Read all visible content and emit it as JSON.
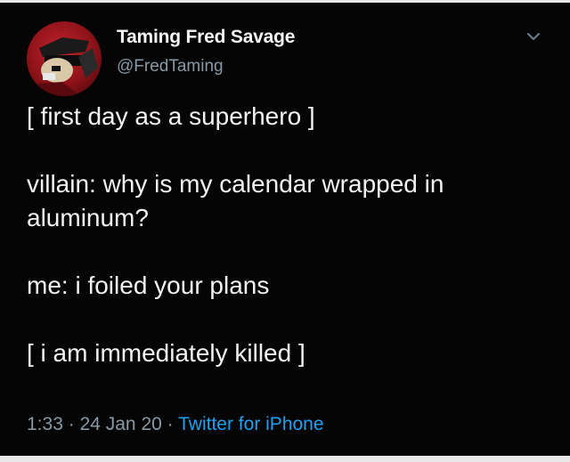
{
  "author": {
    "display_name": "Taming Fred Savage",
    "handle": "@FredTaming"
  },
  "tweet": {
    "paragraphs": [
      "[ first day as a superhero ]",
      "villain: why is my calendar wrapped in aluminum?",
      "me: i foiled your plans",
      "[ i am immediately killed ]"
    ],
    "time": "1:33",
    "separator": "·",
    "date": "24 Jan 20",
    "source": "Twitter for iPhone"
  },
  "icons": {
    "more": "chevron-down-icon",
    "avatar": "avatar"
  },
  "colors": {
    "background": "#050505",
    "text": "#f2f2f2",
    "secondary": "#8899a6",
    "link": "#1da1f2"
  }
}
